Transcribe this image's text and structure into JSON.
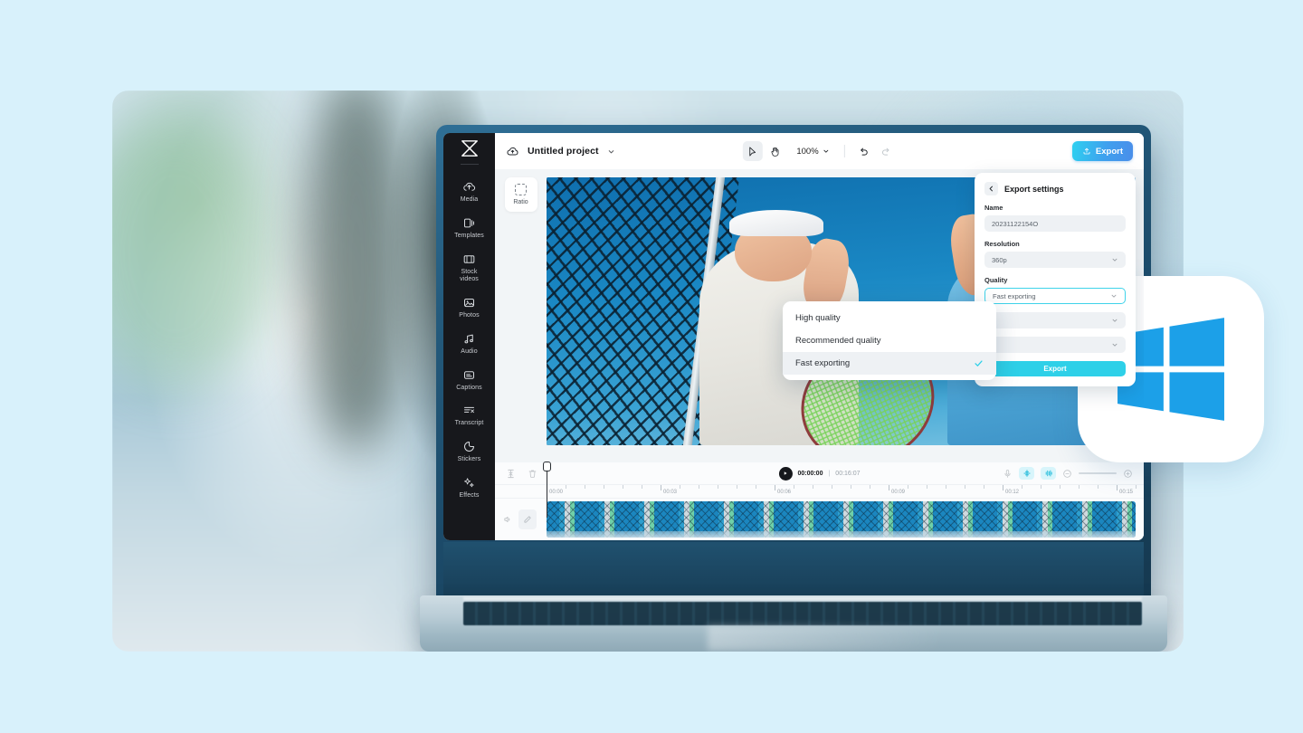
{
  "app": {
    "logo_icon": "capcut-logo-icon",
    "cloud_icon": "cloud-sync-icon",
    "project_title": "Untitled project",
    "title_caret_icon": "chevron-down-icon"
  },
  "sidebar": {
    "items": [
      {
        "label": "Media",
        "icon": "cloud-upload-icon"
      },
      {
        "label": "Templates",
        "icon": "templates-icon"
      },
      {
        "label": "Stock\nvideos",
        "icon": "film-strip-icon"
      },
      {
        "label": "Photos",
        "icon": "image-icon"
      },
      {
        "label": "Audio",
        "icon": "music-note-icon"
      },
      {
        "label": "Captions",
        "icon": "captions-icon"
      },
      {
        "label": "Transcript",
        "icon": "transcript-icon"
      },
      {
        "label": "Stickers",
        "icon": "sticker-icon"
      },
      {
        "label": "Effects",
        "icon": "effects-sparkle-icon"
      }
    ],
    "labels": {
      "media": "Media",
      "templates": "Templates",
      "stock_videos_l1": "Stock",
      "stock_videos_l2": "videos",
      "photos": "Photos",
      "audio": "Audio",
      "captions": "Captions",
      "transcript": "Transcript",
      "stickers": "Stickers",
      "effects": "Effects"
    }
  },
  "toolbar": {
    "select_tool_icon": "cursor-arrow-icon",
    "hand_tool_icon": "hand-icon",
    "zoom_level": "100%",
    "zoom_caret_icon": "chevron-down-icon",
    "undo_icon": "undo-icon",
    "redo_icon": "redo-icon",
    "export_label": "Export",
    "export_icon": "upload-box-icon"
  },
  "stage": {
    "ratio_label": "Ratio",
    "ratio_icon": "crop-dashed-icon"
  },
  "export_settings": {
    "title": "Export settings",
    "back_icon": "chevron-left-icon",
    "name_label": "Name",
    "name_value": "20231122154O",
    "resolution_label": "Resolution",
    "resolution_value": "360p",
    "quality_label": "Quality",
    "quality_value": "Fast exporting",
    "export_button_label": "Export",
    "caret_icon": "chevron-down-icon"
  },
  "quality_dropdown": {
    "options": [
      {
        "label": "High quality",
        "selected": false
      },
      {
        "label": "Recommended quality",
        "selected": false
      },
      {
        "label": "Fast exporting",
        "selected": true
      }
    ],
    "check_icon": "check-icon"
  },
  "timeline": {
    "split_icon": "split-icon",
    "delete_icon": "trash-icon",
    "play_icon": "play-icon",
    "current_time": "00:00:00",
    "time_separator": "|",
    "total_time": "00:16:07",
    "mic_icon": "microphone-icon",
    "auto_captions_icon": "auto-adjust-icon",
    "audio_wave_icon": "audio-wave-icon",
    "zoom_out_icon": "zoom-out-icon",
    "zoom_in_icon": "zoom-in-icon",
    "ruler_labels": [
      "00:00",
      "00:03",
      "00:06",
      "00:09",
      "00:12",
      "00:15"
    ],
    "track_mute_icon": "speaker-icon",
    "track_edit_icon": "pen-edit-icon"
  },
  "badge": {
    "os_icon": "windows-logo-icon"
  },
  "colors": {
    "page_background": "#d8f1fb",
    "sidebar": "#17181c",
    "accent_cyan": "#2ed0e8",
    "export_gradient_start": "#2ed0f0",
    "export_gradient_end": "#4a8eea",
    "windows_blue": "#1ca0e8"
  }
}
